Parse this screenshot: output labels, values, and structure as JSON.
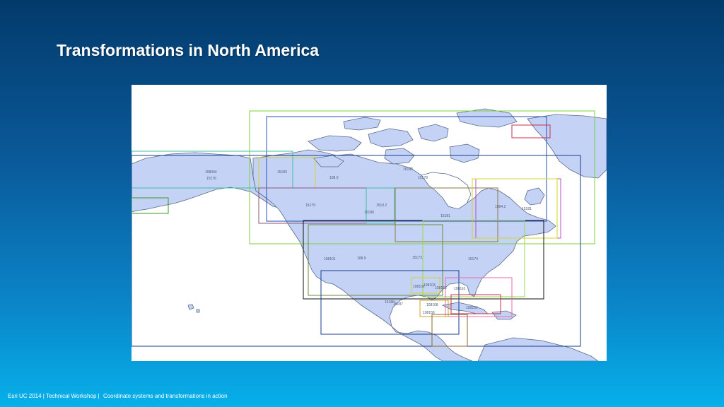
{
  "slide": {
    "title": "Transformations in North America",
    "footer_left": "Esri UC 2014 | Technical Workshop |",
    "footer_right": "Coordinate systems and transformations in action"
  },
  "colors": {
    "land": "#c4d2f5",
    "coast": "#5a6a8a",
    "background": "#ffffff"
  },
  "zone_labels": [
    "108044",
    "15176",
    "15183",
    "108.0",
    "15182",
    "15178",
    "15179",
    "15180",
    "1510.2",
    "15181",
    "1584.2",
    "15181",
    "108101",
    "108.9",
    "15173",
    "15174",
    "108103",
    "108102",
    "15188",
    "108153",
    "108110",
    "15187",
    "108108",
    "108158",
    "108159"
  ]
}
